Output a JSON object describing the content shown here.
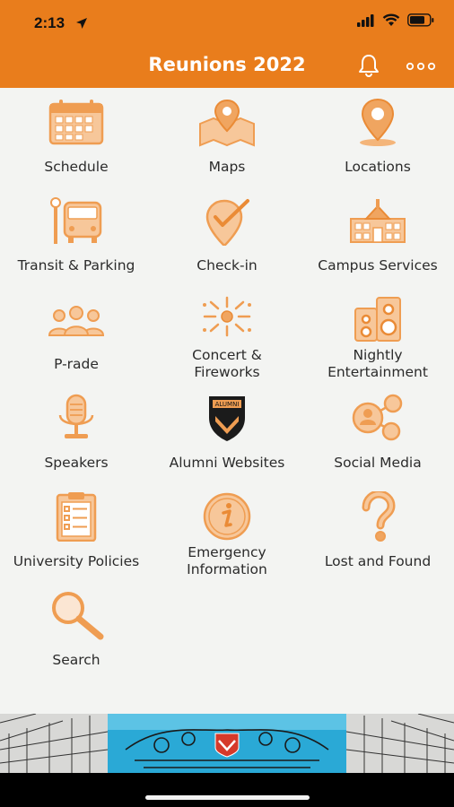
{
  "status": {
    "time": "2:13"
  },
  "header": {
    "title": "Reunions 2022"
  },
  "tiles": [
    {
      "label": "Schedule",
      "icon": "calendar-icon"
    },
    {
      "label": "Maps",
      "icon": "map-icon"
    },
    {
      "label": "Locations",
      "icon": "location-pin-icon"
    },
    {
      "label": "Transit & Parking",
      "icon": "bus-icon"
    },
    {
      "label": "Check-in",
      "icon": "check-in-pin-icon"
    },
    {
      "label": "Campus Services",
      "icon": "building-icon"
    },
    {
      "label": "P-rade",
      "icon": "people-icon"
    },
    {
      "label": "Concert &\nFireworks",
      "icon": "fireworks-icon"
    },
    {
      "label": "Nightly\nEntertainment",
      "icon": "speaker-icon"
    },
    {
      "label": "Speakers",
      "icon": "microphone-icon"
    },
    {
      "label": "Alumni Websites",
      "icon": "alumni-shield-icon"
    },
    {
      "label": "Social Media",
      "icon": "social-network-icon"
    },
    {
      "label": "University Policies",
      "icon": "clipboard-icon"
    },
    {
      "label": "Emergency\nInformation",
      "icon": "info-icon"
    },
    {
      "label": "Lost and Found",
      "icon": "question-mark-icon"
    },
    {
      "label": "Search",
      "icon": "search-icon"
    }
  ],
  "shield_text": "ALUMNI",
  "colors": {
    "accent": "#e97d1c",
    "icon": "#f0a560",
    "background": "#f3f4f2"
  }
}
